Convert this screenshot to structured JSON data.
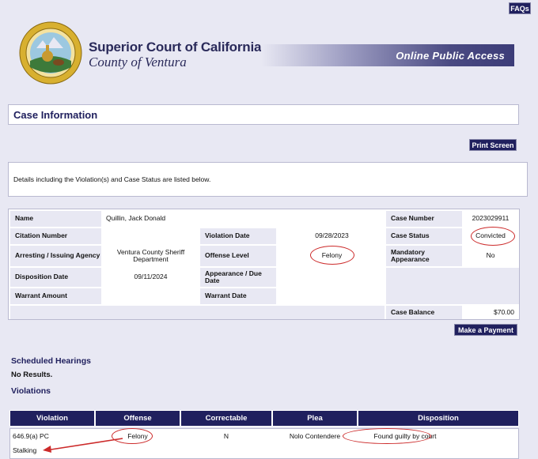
{
  "header": {
    "faqs": "FAQs",
    "court_title": "Superior Court of California",
    "court_subtitle": "County of Ventura",
    "banner": "Online Public Access",
    "seal_text": "THE GREAT SEAL OF THE STATE OF CALIFORNIA"
  },
  "case_info": {
    "title": "Case Information",
    "print_button": "Print Screen",
    "details_text": "Details including the Violation(s) and Case Status are listed below."
  },
  "case_details": {
    "name_label": "Name",
    "name_value": "Quillin, Jack Donald",
    "citation_label": "Citation Number",
    "citation_value": "",
    "arresting_label": "Arresting / Issuing Agency",
    "arresting_value": "Ventura County Sheriff Department",
    "disposition_date_label": "Disposition Date",
    "disposition_date_value": "09/11/2024",
    "warrant_amount_label": "Warrant Amount",
    "warrant_amount_value": "",
    "violation_date_label": "Violation Date",
    "violation_date_value": "09/28/2023",
    "offense_level_label": "Offense Level",
    "offense_level_value": "Felony",
    "appearance_label": "Appearance / Due Date",
    "appearance_value": "",
    "warrant_date_label": "Warrant Date",
    "warrant_date_value": "",
    "case_number_label": "Case Number",
    "case_number_value": "2023029911",
    "case_status_label": "Case Status",
    "case_status_value": "Convicted",
    "mandatory_label": "Mandatory Appearance",
    "mandatory_value": "No",
    "case_balance_label": "Case Balance",
    "case_balance_value": "$70.00",
    "pay_button": "Make a Payment"
  },
  "hearings": {
    "title": "Scheduled Hearings",
    "no_results": "No Results."
  },
  "violations": {
    "title": "Violations",
    "columns": [
      "Violation",
      "Offense",
      "Correctable",
      "Plea",
      "Disposition"
    ],
    "rows": [
      {
        "violation": "646.9(a) PC",
        "offense": "Felony",
        "correctable": "N",
        "plea": "Nolo Contendere",
        "disposition": "Found guilty by court",
        "description": "Stalking"
      }
    ]
  },
  "colors": {
    "navy": "#20205e",
    "page_bg": "#e8e8f3",
    "annotation_red": "#cc2a2a"
  }
}
